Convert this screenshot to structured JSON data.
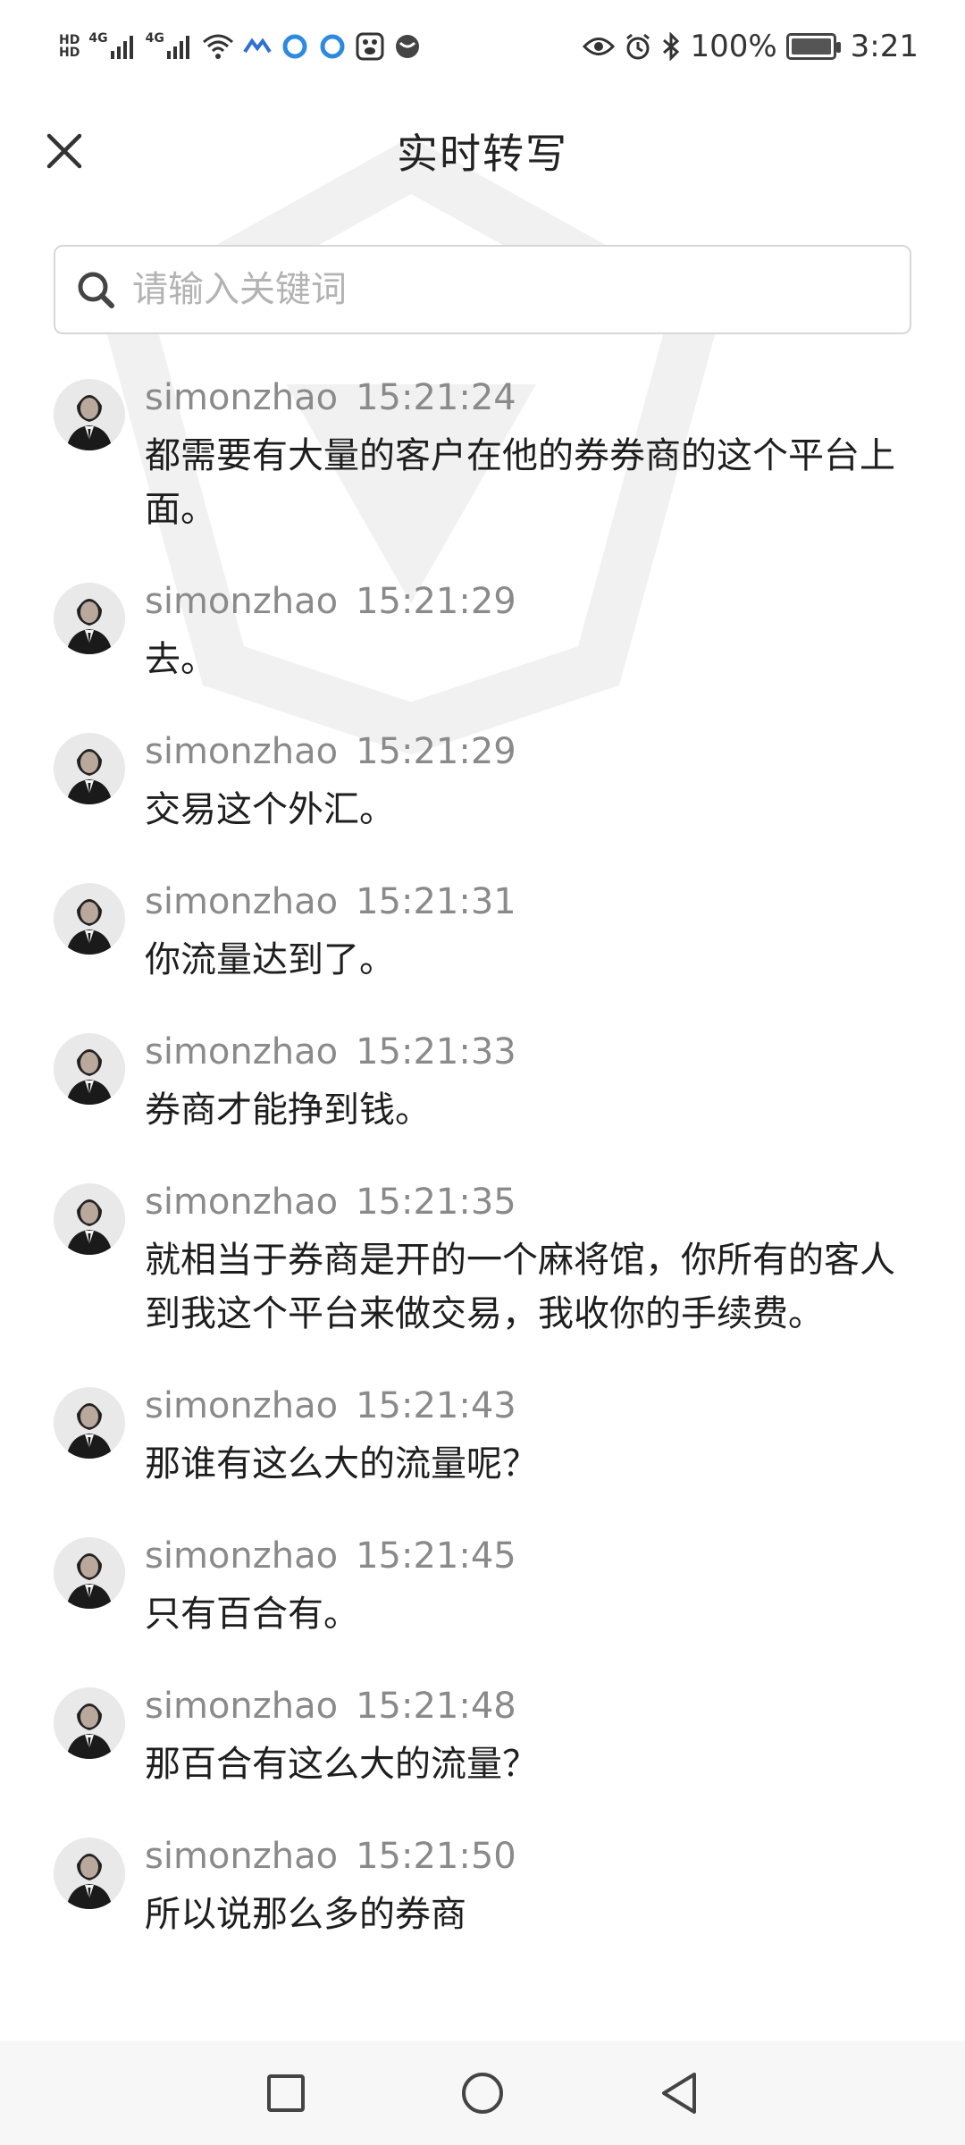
{
  "status_bar": {
    "hd_top": "HD",
    "hd_bottom": "HD",
    "net1": "4G",
    "net2": "4G",
    "battery_pct": "100%",
    "battery_level": 1.0,
    "time": "3:21",
    "icons": [
      "signal-icon",
      "signal-icon",
      "wifi-icon",
      "app-notification-icon",
      "app-notification-icon",
      "app-notification-icon",
      "baidu-icon",
      "app-notification-icon",
      "eye-icon",
      "alarm-icon",
      "bluetooth-icon",
      "battery-icon"
    ]
  },
  "header": {
    "title": "实时转写",
    "close_icon": "close-icon"
  },
  "search": {
    "placeholder": "请输入关键词",
    "value": ""
  },
  "transcript": [
    {
      "speaker": "simonzhao",
      "time": "15:21:24",
      "text": "都需要有大量的客户在他的券券商的这个平台上面。"
    },
    {
      "speaker": "simonzhao",
      "time": "15:21:29",
      "text": "去。"
    },
    {
      "speaker": "simonzhao",
      "time": "15:21:29",
      "text": "交易这个外汇。"
    },
    {
      "speaker": "simonzhao",
      "time": "15:21:31",
      "text": "你流量达到了。"
    },
    {
      "speaker": "simonzhao",
      "time": "15:21:33",
      "text": "券商才能挣到钱。"
    },
    {
      "speaker": "simonzhao",
      "time": "15:21:35",
      "text": "就相当于券商是开的一个麻将馆，你所有的客人到我这个平台来做交易，我收你的手续费。"
    },
    {
      "speaker": "simonzhao",
      "time": "15:21:43",
      "text": "那谁有这么大的流量呢？"
    },
    {
      "speaker": "simonzhao",
      "time": "15:21:45",
      "text": "只有百合有。"
    },
    {
      "speaker": "simonzhao",
      "time": "15:21:48",
      "text": "那百合有这么大的流量？"
    },
    {
      "speaker": "simonzhao",
      "time": "15:21:50",
      "text": "所以说那么多的券商"
    }
  ],
  "nav": {
    "recents_icon": "square-icon",
    "home_icon": "circle-icon",
    "back_icon": "triangle-back-icon"
  }
}
